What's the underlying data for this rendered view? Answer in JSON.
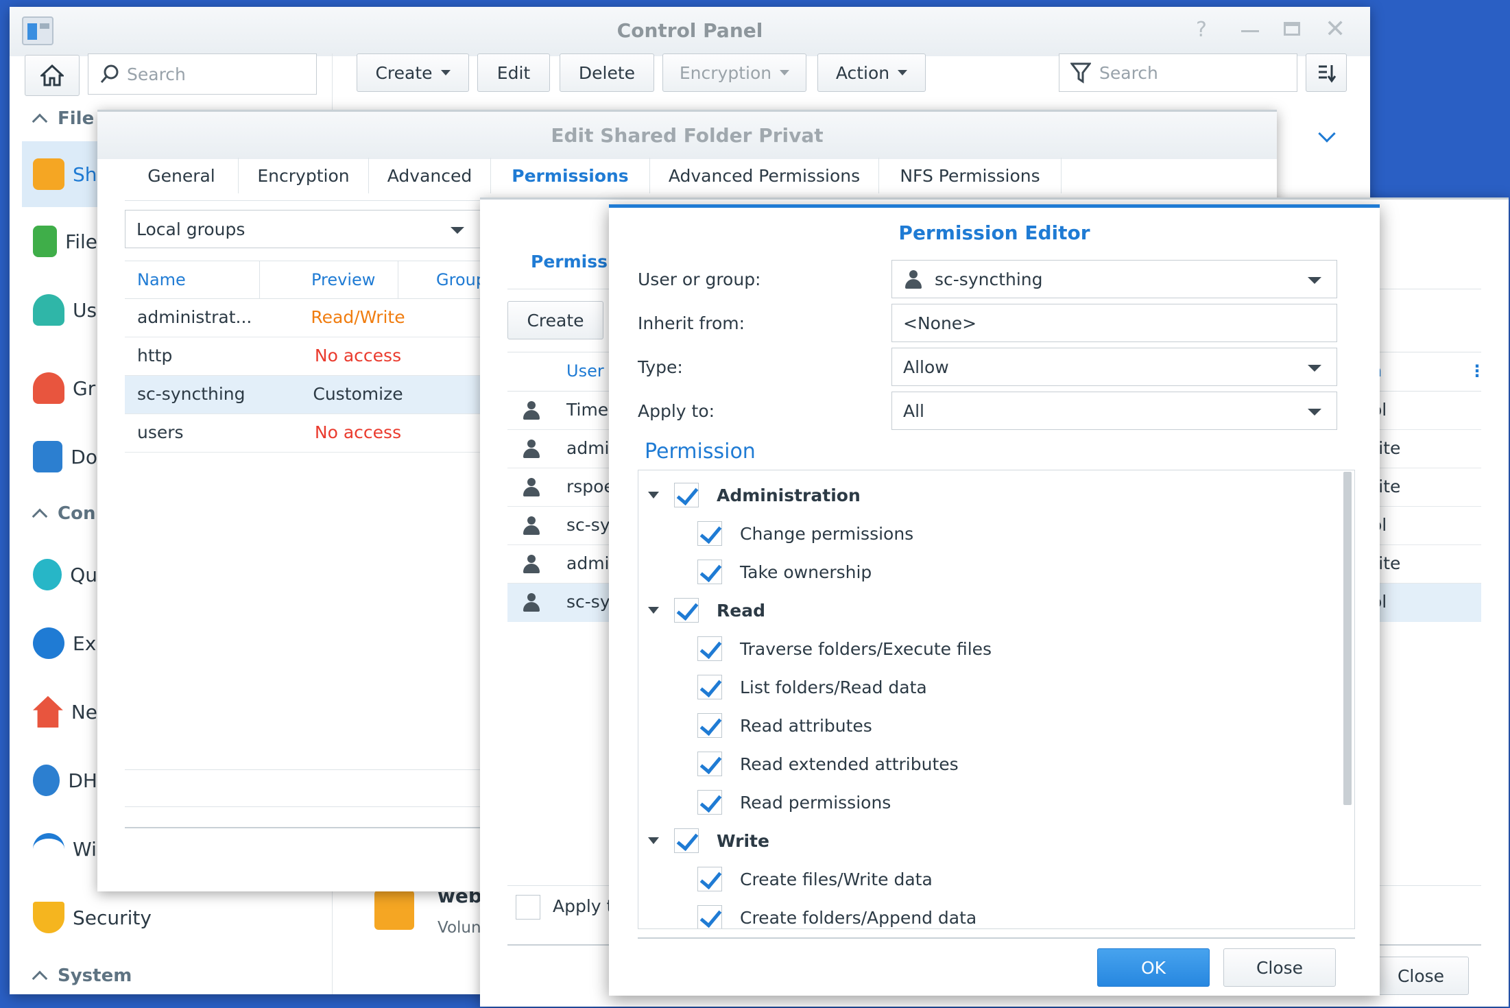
{
  "control_panel": {
    "title": "Control Panel",
    "search_placeholder": "Search",
    "toolbar": {
      "create": "Create",
      "edit": "Edit",
      "delete": "Delete",
      "encryption": "Encryption",
      "action": "Action",
      "search_placeholder": "Search"
    },
    "sidebar": {
      "section_file": "File",
      "section_con": "Con",
      "section_system": "System",
      "items": [
        {
          "label": "Sh",
          "icon": "shared-folder-icon"
        },
        {
          "label": "File",
          "icon": "file-services-icon"
        },
        {
          "label": "Us",
          "icon": "user-icon"
        },
        {
          "label": "Gr",
          "icon": "group-icon"
        },
        {
          "label": "Do",
          "icon": "domain-icon"
        },
        {
          "label": "Qu",
          "icon": "quickconnect-icon"
        },
        {
          "label": "Ex",
          "icon": "external-access-icon"
        },
        {
          "label": "Ne",
          "icon": "network-icon"
        },
        {
          "label": "DH",
          "icon": "dhcp-icon"
        },
        {
          "label": "Wi",
          "icon": "wireless-icon"
        },
        {
          "label": "Security",
          "icon": "security-icon"
        }
      ]
    },
    "list_item": {
      "name": "web",
      "sub": "Volun"
    }
  },
  "edit_folder": {
    "title": "Edit Shared Folder Privat",
    "tabs": [
      "General",
      "Encryption",
      "Advanced",
      "Permissions",
      "Advanced Permissions",
      "NFS Permissions"
    ],
    "group_select": "Local groups",
    "columns": {
      "name": "Name",
      "preview": "Preview",
      "group": "Group"
    },
    "rows": [
      {
        "name": "administrat...",
        "preview": "Read/Write",
        "color": "#f07d10"
      },
      {
        "name": "http",
        "preview": "No access",
        "color": "#ea3b2e"
      },
      {
        "name": "sc-syncthing",
        "preview": "Customize",
        "color": "#2c3a45"
      },
      {
        "name": "users",
        "preview": "No access",
        "color": "#ea3b2e"
      }
    ]
  },
  "permissions_dialog": {
    "tab_label": "Permissi",
    "create": "Create",
    "col_user": "User",
    "col_right": "n",
    "users": [
      {
        "name": "Timel",
        "right": "ol",
        "group": false
      },
      {
        "name": "admir",
        "right": "rite",
        "group": false
      },
      {
        "name": "rspoe",
        "right": "rite",
        "group": false
      },
      {
        "name": "sc-sy",
        "right": "ol",
        "group": false
      },
      {
        "name": "admir",
        "right": "rite",
        "group": true
      },
      {
        "name": "sc-sy",
        "right": "ol",
        "group": true
      }
    ],
    "apply_label": "Apply t",
    "close": "Close"
  },
  "permission_editor": {
    "title": "Permission Editor",
    "user_or_group_label": "User or group:",
    "user_or_group_value": "sc-syncthing",
    "inherit_label": "Inherit from:",
    "inherit_value": "<None>",
    "type_label": "Type:",
    "type_value": "Allow",
    "apply_label": "Apply to:",
    "apply_value": "All",
    "permission_heading": "Permission",
    "groups": [
      {
        "label": "Administration",
        "items": [
          "Change permissions",
          "Take ownership"
        ]
      },
      {
        "label": "Read",
        "items": [
          "Traverse folders/Execute files",
          "List folders/Read data",
          "Read attributes",
          "Read extended attributes",
          "Read permissions"
        ]
      },
      {
        "label": "Write",
        "items": [
          "Create files/Write data",
          "Create folders/Append data"
        ]
      }
    ],
    "ok": "OK",
    "close": "Close"
  }
}
